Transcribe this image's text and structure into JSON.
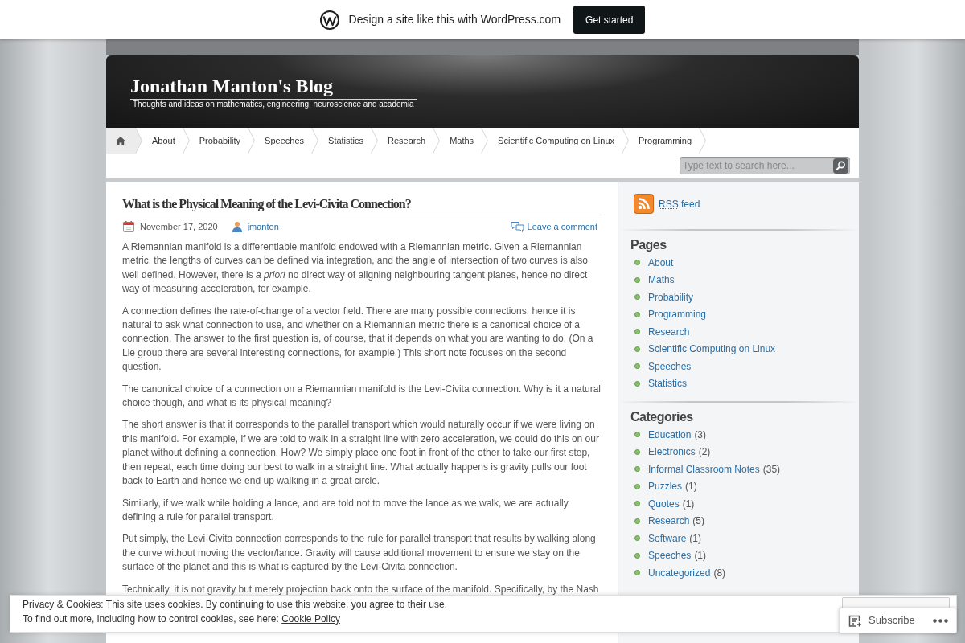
{
  "promo_bar": {
    "text": "Design a site like this with WordPress.com",
    "button": "Get started"
  },
  "header": {
    "title": "Jonathan Manton's Blog",
    "tagline": "Thoughts and ideas on mathematics, engineering, neuroscience and academia"
  },
  "nav": {
    "items": [
      {
        "kind": "home",
        "selected": true
      },
      {
        "kind": "page",
        "label": "About",
        "selected": false
      },
      {
        "kind": "page",
        "label": "Probability",
        "selected": false
      },
      {
        "kind": "page",
        "label": "Speeches",
        "selected": false
      },
      {
        "kind": "page",
        "label": "Statistics",
        "selected": false
      },
      {
        "kind": "page",
        "label": "Research",
        "selected": false
      },
      {
        "kind": "page",
        "label": "Maths",
        "selected": false
      },
      {
        "kind": "page",
        "label": "Scientific Computing on Linux",
        "selected": false
      },
      {
        "kind": "page",
        "label": "Programming",
        "selected": false
      }
    ]
  },
  "search": {
    "placeholder": "Type text to search here..."
  },
  "post": {
    "title": "What is the Physical Meaning of the Levi-Civita Connection?",
    "date": "November 17, 2020",
    "author": "jmanton",
    "comments_link": "Leave a comment",
    "paragraphs": [
      "A Riemannian manifold is a differentiable manifold endowed with a Riemannian metric. Given a Riemannian metric, the lengths of curves can be defined via integration, and the angle of intersection of two curves is also well defined. However, there is *a priori* no direct way of aligning neighbouring tangent planes, hence no direct way of measuring acceleration, for example.",
      "A connection defines the rate-of-change of a vector field. There are many possible connections, hence it is natural to ask what connection to use, and whether on a Riemannian metric there is a canonical choice of a connection. The answer to the first question is, of course, that it depends on what you are wanting to do. (On a Lie group there are several interesting connections, for example.) This short note focuses on the second question.",
      "The canonical choice of a connection on a Riemannian manifold is the Levi-Civita connection. Why is it a natural choice though, and what is its physical meaning?",
      "The short answer is that it corresponds to the parallel transport which would naturally occur if we were living on this manifold. For example, if we are told to walk in a straight line with zero acceleration, we could do this on our planet without defining a connection. How? We simply place one foot in front of the other to take our first step, then repeat, each time doing our best to walk in a straight line. What actually happens is gravity pulls our foot back to Earth and hence we end up walking in a great circle.",
      "Similarly, if we walk while holding a lance, and are told not to move the lance as we walk, we are actually defining a rule for parallel transport.",
      "Put simply, the Levi-Civita connection corresponds to the rule for parallel transport that results by walking along the curve without moving the vector/lance. Gravity will cause additional movement to ensure we stay on the surface of the planet and this is what is captured by the Levi-Civita connection.",
      "Technically, it is not gravity but merely projection back onto the surface of the manifold. Specifically, by the Nash"
    ]
  },
  "sidebar": {
    "rss": {
      "abbr": "RSS",
      "label": "feed"
    },
    "widgets": [
      {
        "title": "Pages",
        "items": [
          {
            "label": "About"
          },
          {
            "label": "Maths"
          },
          {
            "label": "Probability"
          },
          {
            "label": "Programming"
          },
          {
            "label": "Research"
          },
          {
            "label": "Scientific Computing on Linux"
          },
          {
            "label": "Speeches"
          },
          {
            "label": "Statistics"
          }
        ]
      },
      {
        "title": "Categories",
        "items": [
          {
            "label": "Education",
            "count": "(3)"
          },
          {
            "label": "Electronics",
            "count": "(2)"
          },
          {
            "label": "Informal Classroom Notes",
            "count": "(35)"
          },
          {
            "label": "Puzzles",
            "count": "(1)"
          },
          {
            "label": "Quotes",
            "count": "(1)"
          },
          {
            "label": "Research",
            "count": "(5)"
          },
          {
            "label": "Software",
            "count": "(1)"
          },
          {
            "label": "Speeches",
            "count": "(1)"
          },
          {
            "label": "Uncategorized",
            "count": "(8)"
          }
        ]
      }
    ]
  },
  "cookie_banner": {
    "notice": "Privacy & Cookies: This site uses cookies. By continuing to use this website, you agree to their use.",
    "more_info": "To find out more, including how to control cookies, see here:",
    "link": "Cookie Policy"
  },
  "subscribe_bar": {
    "label": "Subscribe"
  }
}
